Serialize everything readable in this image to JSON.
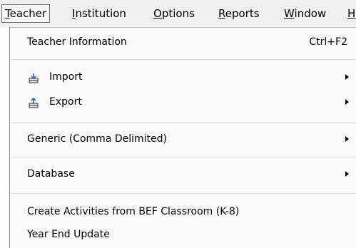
{
  "menubar": {
    "items": [
      {
        "label": "Teacher",
        "mnemonic": "T",
        "rest": "eacher"
      },
      {
        "label": "Institution",
        "mnemonic": "I",
        "rest": "nstitution"
      },
      {
        "label": "Options",
        "mnemonic": "O",
        "rest": "ptions"
      },
      {
        "label": "Reports",
        "mnemonic": "R",
        "rest": "eports"
      },
      {
        "label": "Window",
        "mnemonic": "W",
        "rest": "indow"
      },
      {
        "label": "H",
        "mnemonic": "H",
        "rest": ""
      }
    ]
  },
  "menu": {
    "teacher_information": {
      "label": "Teacher Information",
      "shortcut": "Ctrl+F2"
    },
    "import": {
      "label": "Import",
      "icon": "import-icon"
    },
    "export": {
      "label": "Export",
      "icon": "export-icon"
    },
    "generic": {
      "label": "Generic (Comma Delimited)"
    },
    "database": {
      "label": "Database"
    },
    "create_activities": {
      "label": "Create Activities from BEF Classroom (K-8)"
    },
    "year_end_update": {
      "label": "Year End Update"
    }
  },
  "colors": {
    "menu_bg": "#fafafa",
    "menubar_bg": "#f0f0f0"
  }
}
